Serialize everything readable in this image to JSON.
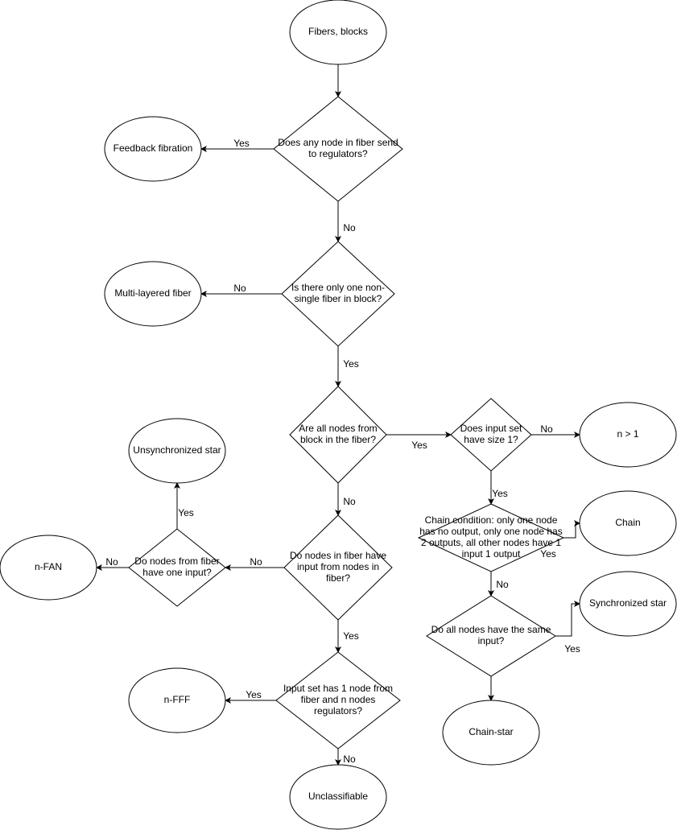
{
  "diagram": {
    "stroke_color": "#000000",
    "fill_color": "#ffffff",
    "nodes": [
      {
        "id": "fibers",
        "shape": "ellipse",
        "lines": [
          "Fibers, blocks"
        ]
      },
      {
        "id": "q-send-regulators",
        "shape": "diamond",
        "lines": [
          "Does any node in fiber send",
          "to regulators?"
        ]
      },
      {
        "id": "feedback",
        "shape": "ellipse",
        "lines": [
          "Feedback fibration"
        ]
      },
      {
        "id": "q-one-nonsingle",
        "shape": "diamond",
        "lines": [
          "Is there only one non-",
          "single fiber in block?"
        ]
      },
      {
        "id": "multilayer",
        "shape": "ellipse",
        "lines": [
          "Multi-layered fiber"
        ]
      },
      {
        "id": "q-all-in-fiber",
        "shape": "diamond",
        "lines": [
          "Are all nodes from",
          "block in the fiber?"
        ]
      },
      {
        "id": "q-input-size",
        "shape": "diamond",
        "lines": [
          "Does input set",
          "have size 1?"
        ]
      },
      {
        "id": "n-gt-1",
        "shape": "ellipse",
        "lines": [
          "n > 1"
        ]
      },
      {
        "id": "q-chain",
        "shape": "diamond",
        "lines": [
          "Chain condition: only one node",
          "has no output, only one node has",
          "2 outputs, all other nodes have 1",
          "input 1 output"
        ]
      },
      {
        "id": "chain",
        "shape": "ellipse",
        "lines": [
          "Chain"
        ]
      },
      {
        "id": "q-same-input",
        "shape": "diamond",
        "lines": [
          "Do all nodes have the same",
          "input?"
        ]
      },
      {
        "id": "sync-star",
        "shape": "ellipse",
        "lines": [
          "Synchronized star"
        ]
      },
      {
        "id": "chain-star",
        "shape": "ellipse",
        "lines": [
          "Chain-star"
        ]
      },
      {
        "id": "q-input-from-fiber",
        "shape": "diamond",
        "lines": [
          "Do nodes in fiber have",
          "input from nodes in",
          "fiber?"
        ]
      },
      {
        "id": "q-one-input",
        "shape": "diamond",
        "lines": [
          "Do nodes from fiber",
          "have one input?"
        ]
      },
      {
        "id": "unsync-star",
        "shape": "ellipse",
        "lines": [
          "Unsynchronized star"
        ]
      },
      {
        "id": "n-fan",
        "shape": "ellipse",
        "lines": [
          "n-FAN"
        ]
      },
      {
        "id": "q-input-set",
        "shape": "diamond",
        "lines": [
          "Input set has 1 node from",
          "fiber and n nodes",
          "regulators?"
        ]
      },
      {
        "id": "n-fff",
        "shape": "ellipse",
        "lines": [
          "n-FFF"
        ]
      },
      {
        "id": "unclassifiable",
        "shape": "ellipse",
        "lines": [
          "Unclassifiable"
        ]
      }
    ],
    "edges": [
      {
        "from": "fibers",
        "to": "q-send-regulators",
        "label": ""
      },
      {
        "from": "q-send-regulators",
        "to": "feedback",
        "label": "Yes"
      },
      {
        "from": "q-send-regulators",
        "to": "q-one-nonsingle",
        "label": "No"
      },
      {
        "from": "q-one-nonsingle",
        "to": "multilayer",
        "label": "No"
      },
      {
        "from": "q-one-nonsingle",
        "to": "q-all-in-fiber",
        "label": "Yes"
      },
      {
        "from": "q-all-in-fiber",
        "to": "q-input-size",
        "label": "Yes"
      },
      {
        "from": "q-input-size",
        "to": "n-gt-1",
        "label": "No"
      },
      {
        "from": "q-input-size",
        "to": "q-chain",
        "label": "Yes"
      },
      {
        "from": "q-chain",
        "to": "chain",
        "label": "Yes"
      },
      {
        "from": "q-chain",
        "to": "q-same-input",
        "label": "No"
      },
      {
        "from": "q-same-input",
        "to": "sync-star",
        "label": "Yes"
      },
      {
        "from": "q-same-input",
        "to": "chain-star",
        "label": ""
      },
      {
        "from": "q-all-in-fiber",
        "to": "q-input-from-fiber",
        "label": "No"
      },
      {
        "from": "q-input-from-fiber",
        "to": "q-one-input",
        "label": "No"
      },
      {
        "from": "q-one-input",
        "to": "n-fan",
        "label": "No"
      },
      {
        "from": "q-one-input",
        "to": "unsync-star",
        "label": "Yes"
      },
      {
        "from": "q-input-from-fiber",
        "to": "q-input-set",
        "label": "Yes"
      },
      {
        "from": "q-input-set",
        "to": "n-fff",
        "label": "Yes"
      },
      {
        "from": "q-input-set",
        "to": "unclassifiable",
        "label": "No"
      }
    ]
  }
}
